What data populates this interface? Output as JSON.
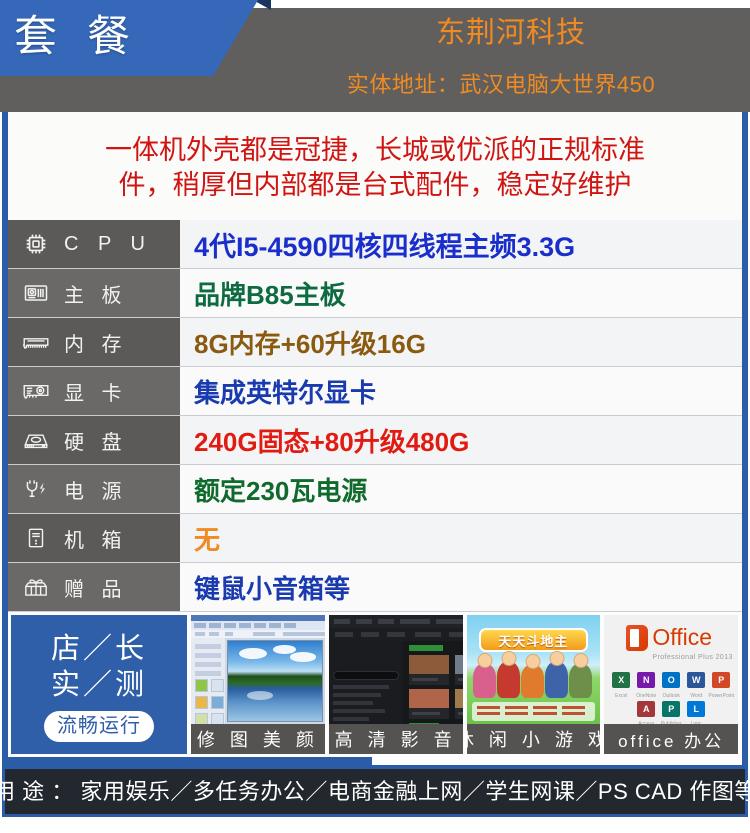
{
  "header": {
    "badge": "套 餐",
    "company": "东荆河科技",
    "address": "实体地址：武汉电脑大世界450"
  },
  "blurb": {
    "line1": "一体机外壳都是冠捷，长城或优派的正规标准",
    "line2": "件，稍厚但内部都是台式配件，稳定好维护"
  },
  "specs": [
    {
      "icon": "cpu-icon",
      "label": "C P U",
      "latin": true,
      "value": "4代I5-4590四核四线程主频3.3G",
      "color": "#1a2ecb"
    },
    {
      "icon": "motherboard-icon",
      "label": "主 板",
      "latin": false,
      "value": "品牌B85主板",
      "color": "#0d6b3f"
    },
    {
      "icon": "ram-icon",
      "label": "内 存",
      "latin": false,
      "value": "8G内存+60升级16G",
      "color": "#8a5a10"
    },
    {
      "icon": "gpu-icon",
      "label": "显 卡",
      "latin": false,
      "value": "集成英特尔显卡",
      "color": "#1a3bb0"
    },
    {
      "icon": "harddisk-icon",
      "label": "硬 盘",
      "latin": false,
      "value": "240G固态+80升级480G",
      "color": "#e11b12"
    },
    {
      "icon": "power-icon",
      "label": "电 源",
      "latin": false,
      "value": "额定230瓦电源",
      "color": "#0f6b2c"
    },
    {
      "icon": "case-icon",
      "label": "机 箱",
      "latin": false,
      "value": "无",
      "color": "#f08a23"
    },
    {
      "icon": "gift-icon",
      "label": "赠 品",
      "latin": false,
      "value": "键鼠小音箱等",
      "color": "#1a3bb0"
    }
  ],
  "showcase": {
    "title_line1": "店／长",
    "title_line2": "实／测",
    "badge": "流畅运行",
    "thumbs": [
      {
        "caption": "修 图 美 颜",
        "latin": false
      },
      {
        "caption": "高 清 影 音",
        "latin": false
      },
      {
        "caption": "休 闲 小 游 戏",
        "latin": false
      },
      {
        "caption": "office 办公",
        "latin": true
      }
    ],
    "game_banner": "天天斗地主",
    "office_word": "Office",
    "office_sub": "Professional Plus 2013",
    "office_tiles": [
      {
        "letter": "X",
        "name": "Excel",
        "color": "#217346"
      },
      {
        "letter": "N",
        "name": "OneNote",
        "color": "#7719aa"
      },
      {
        "letter": "O",
        "name": "Outlook",
        "color": "#0072c6"
      },
      {
        "letter": "W",
        "name": "Word",
        "color": "#2b579a"
      },
      {
        "letter": "P",
        "name": "PowerPoint",
        "color": "#d24726"
      },
      {
        "letter": "A",
        "name": "Access",
        "color": "#a4373a"
      },
      {
        "letter": "P",
        "name": "Publisher",
        "color": "#077568"
      },
      {
        "letter": "L",
        "name": "Lync",
        "color": "#0078d7"
      }
    ]
  },
  "footer": {
    "text": "用 途 ： 家用娱乐／多任务办公／电商金融上网／学生网课／PS CAD 作图等"
  },
  "colors": {
    "brand_blue": "#2a5ca8",
    "header_blue": "#3568b8",
    "header_gray": "#605f5d",
    "accent_orange": "#f08a23",
    "blurb_red": "#cf1412",
    "label_gray": "#5b5a58",
    "footer_dark": "#23282f"
  }
}
